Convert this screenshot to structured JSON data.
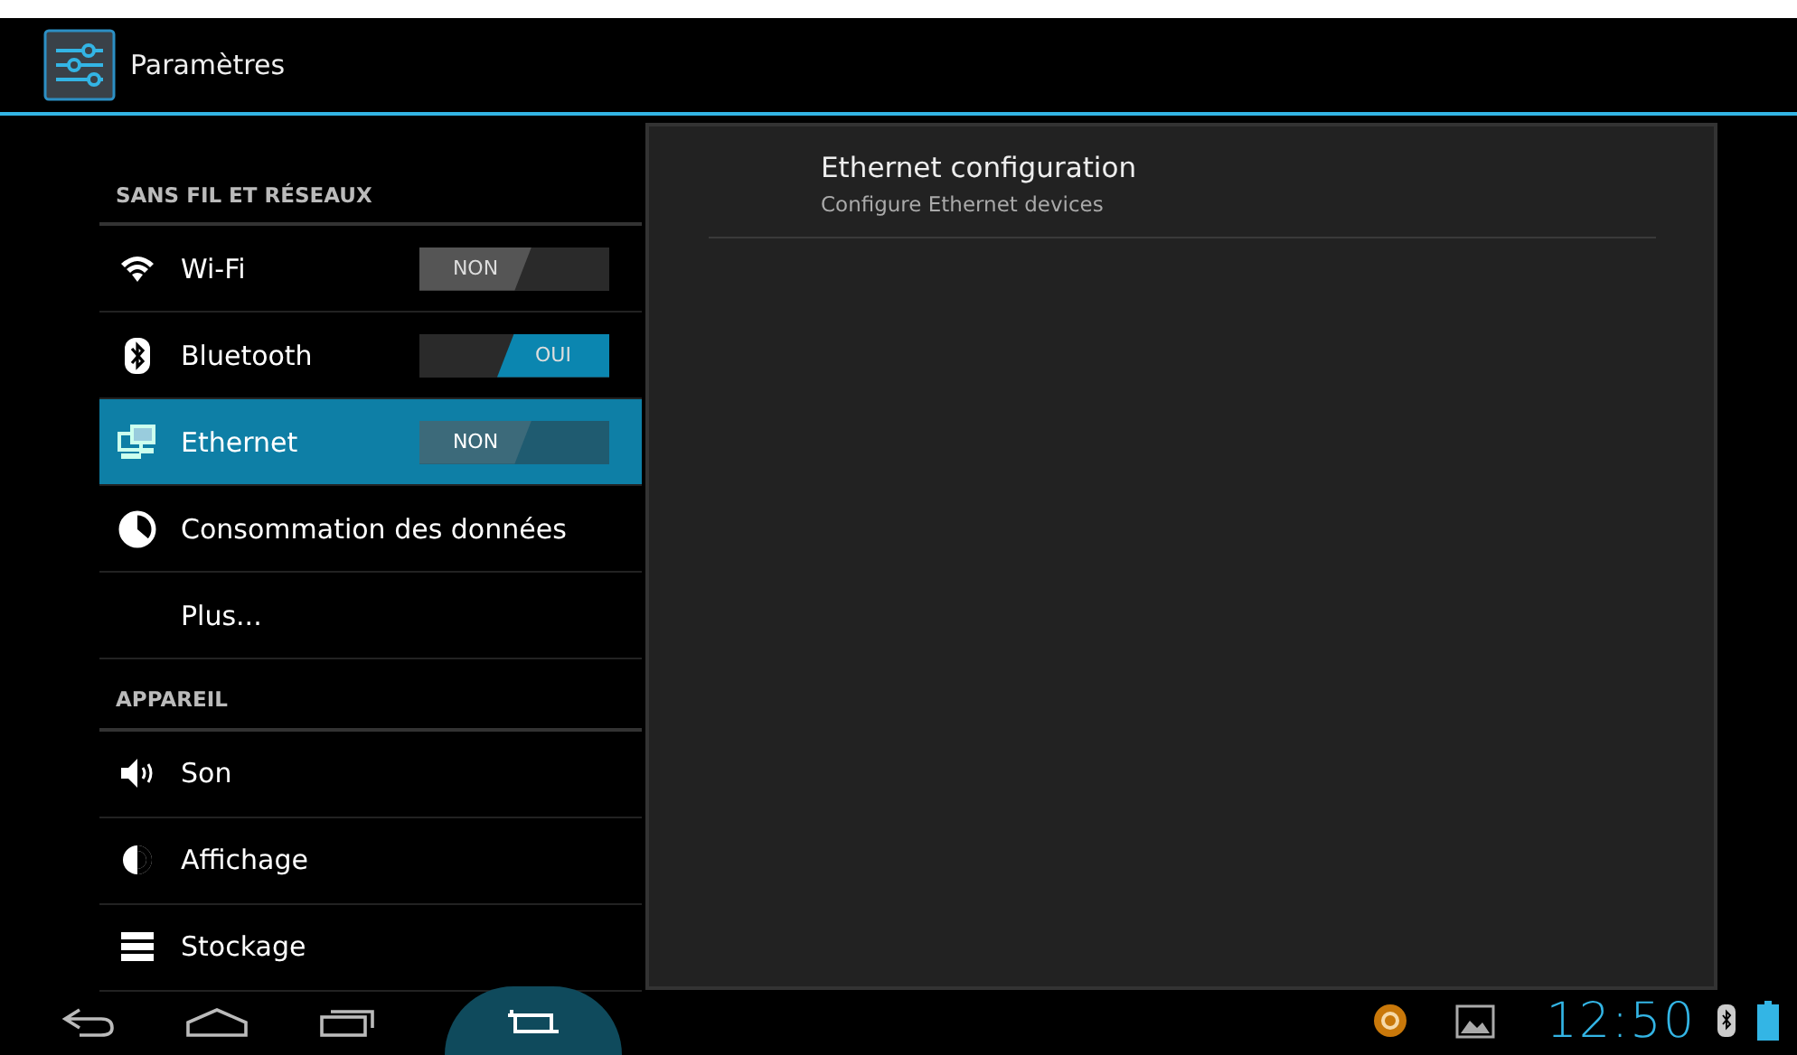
{
  "action_bar": {
    "title": "Paramètres"
  },
  "sidebar": {
    "sections": [
      {
        "header": "SANS FIL ET RÉSEAUX",
        "items": [
          {
            "kind": "toggle",
            "label": "Wi-Fi",
            "selected": false,
            "on": false,
            "toggle_text": "NON"
          },
          {
            "kind": "toggle",
            "label": "Bluetooth",
            "selected": false,
            "on": true,
            "toggle_text": "OUI"
          },
          {
            "kind": "toggle",
            "label": "Ethernet",
            "selected": true,
            "on": false,
            "toggle_text": "NON"
          },
          {
            "kind": "plain",
            "label": "Consommation des données",
            "selected": false
          },
          {
            "kind": "plain",
            "label": "Plus...",
            "selected": false
          }
        ]
      },
      {
        "header": "APPAREIL",
        "items": [
          {
            "kind": "plain",
            "label": "Son",
            "selected": false
          },
          {
            "kind": "plain",
            "label": "Affichage",
            "selected": false
          },
          {
            "kind": "plain",
            "label": "Stockage",
            "selected": false
          }
        ]
      }
    ]
  },
  "detail": {
    "items": [
      {
        "title": "Ethernet configuration",
        "summary": "Configure Ethernet devices"
      }
    ]
  },
  "status_bar": {
    "time": "12:50"
  }
}
